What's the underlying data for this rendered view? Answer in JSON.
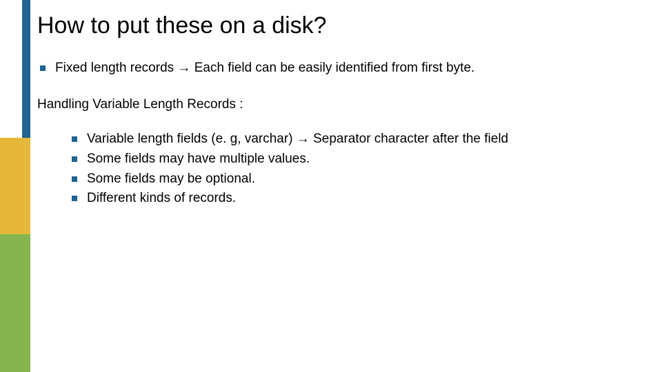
{
  "slide": {
    "title": "How to put these on a disk?",
    "bullets": [
      "Fixed length records → Each field can be easily identified from first byte."
    ],
    "subhead": "Handling Variable Length Records :",
    "sub_bullets": [
      "Variable length fields (e. g, varchar)  → Separator character after the field",
      "Some fields may have multiple values.",
      "Some fields may be optional.",
      "Different kinds of records."
    ]
  }
}
